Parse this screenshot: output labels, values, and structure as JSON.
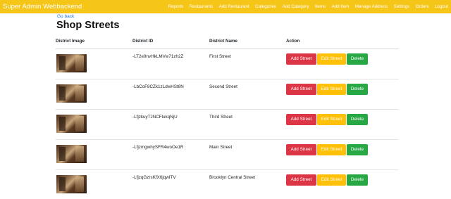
{
  "navbar": {
    "brand": "Super Admin Webbackend",
    "links": [
      "Reports",
      "Restaurants",
      "Add Restaurant",
      "Categories",
      "Add Category",
      "Items",
      "Add Item",
      "Manage Address",
      "Settings",
      "Orders",
      "Logout"
    ]
  },
  "page": {
    "back_label": "Go back",
    "title": "Shop Streets"
  },
  "table": {
    "headers": [
      "District Image",
      "District ID",
      "District Name",
      "Action"
    ],
    "rows": [
      {
        "id": "-LT2e9nvHkLMVw71zh2Z",
        "name": "First Street"
      },
      {
        "id": "-LbCoF8CZk1zLdwHSt8N",
        "name": "Second Street"
      },
      {
        "id": "-LfjzkuyTJNCFlukqNjU",
        "name": "Third Street"
      },
      {
        "id": "-LfjzmgwhySFR4woOe1R",
        "name": "Main Street"
      },
      {
        "id": "-LfjzqGzrsKfX6jqwITV",
        "name": "Brooklyn Central Street"
      }
    ],
    "actions": {
      "add": "Add Street",
      "edit": "Edit Street",
      "delete": "Delete"
    }
  },
  "colors": {
    "navbar": "#f5c518",
    "add_button": "#dc3545",
    "edit_button": "#ffc107",
    "delete_button": "#28a745",
    "link": "#1a73e8"
  }
}
